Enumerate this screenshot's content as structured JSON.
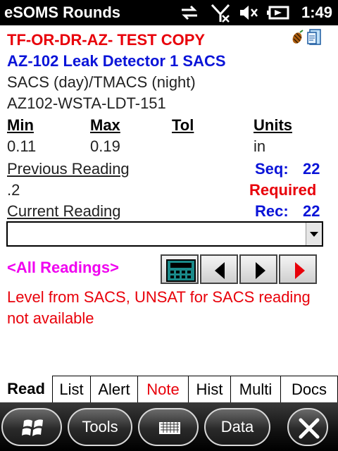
{
  "statusbar": {
    "title": "eSOMS Rounds",
    "time": "1:49",
    "icons": [
      "sync-icon",
      "no-signal-icon",
      "speaker-mute-icon",
      "battery-icon"
    ]
  },
  "reading": {
    "header_red": "TF-OR-DR-AZ- TEST COPY",
    "header_blue": "AZ-102 Leak Detector 1 SACS",
    "line1": "SACS (day)/TMACS (night)",
    "line2": "AZ102-WSTA-LDT-151",
    "min_label": "Min",
    "max_label": "Max",
    "tol_label": "Tol",
    "units_label": "Units",
    "min_value": "0.11",
    "max_value": "0.19",
    "units_value": "in",
    "previous_label": "Previous Reading",
    "seq_label": "Seq:",
    "seq_value": "22",
    "previous_value": ".2",
    "required_label": "Required",
    "current_label": "Current Reading",
    "rec_label": "Rec:",
    "rec_value": "22",
    "current_value": "",
    "all_readings_link": "<All Readings>",
    "note_text_line1": "Level from SACS, UNSAT for SACS reading",
    "note_text_line2": "not available"
  },
  "tabs": [
    {
      "label": "Read",
      "active": true
    },
    {
      "label": "List"
    },
    {
      "label": "Alert"
    },
    {
      "label": "Note",
      "color": "#e8000a"
    },
    {
      "label": "Hist"
    },
    {
      "label": "Multi"
    },
    {
      "label": "Docs"
    }
  ],
  "bottombar": {
    "tools_label": "Tools",
    "data_label": "Data"
  },
  "colors": {
    "red": "#e8000a",
    "blue": "#0a14d8",
    "magenta": "#f000f0",
    "calc_teal": "#1a8a8a"
  }
}
